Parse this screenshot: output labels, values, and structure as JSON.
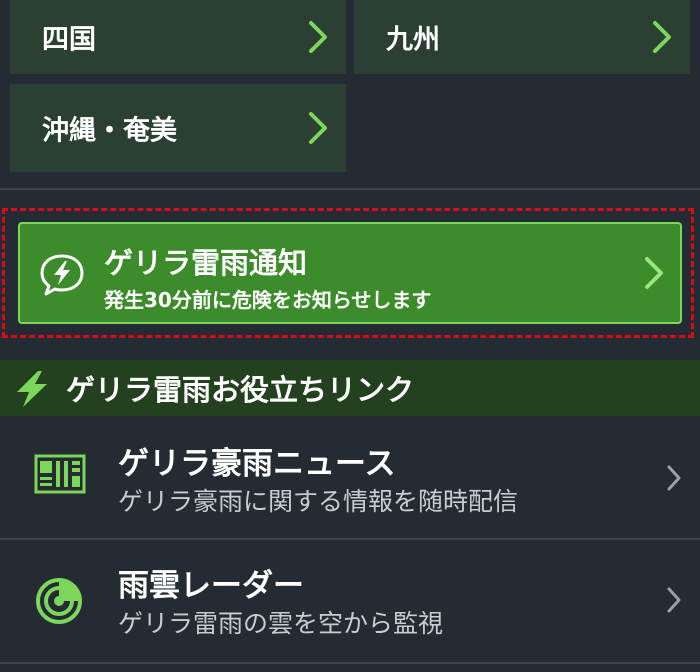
{
  "regions": [
    {
      "label": "四国",
      "icon": "chevron-right-icon"
    },
    {
      "label": "九州",
      "icon": "chevron-right-icon"
    },
    {
      "label": "沖縄・奄美",
      "icon": "chevron-right-icon"
    }
  ],
  "notification": {
    "title": "ゲリラ雷雨通知",
    "subtitle": "発生30分前に危険をお知らせします",
    "icon": "lightning-bubble-icon"
  },
  "section": {
    "title": "ゲリラ雷雨お役立ちリンク",
    "icon": "lightning-icon"
  },
  "links": [
    {
      "title": "ゲリラ豪雨ニュース",
      "description": "ゲリラ豪雨に関する情報を随時配信",
      "icon": "news-icon"
    },
    {
      "title": "雨雲レーダー",
      "description": "ゲリラ雷雨の雲を空から監視",
      "icon": "radar-icon"
    }
  ],
  "colors": {
    "background": "#252b33",
    "region_button": "#2b3f33",
    "accent_green": "#7bd65a",
    "notify_button": "#3d8c2c",
    "highlight_border": "#d40d16",
    "section_header": "#23411f"
  }
}
